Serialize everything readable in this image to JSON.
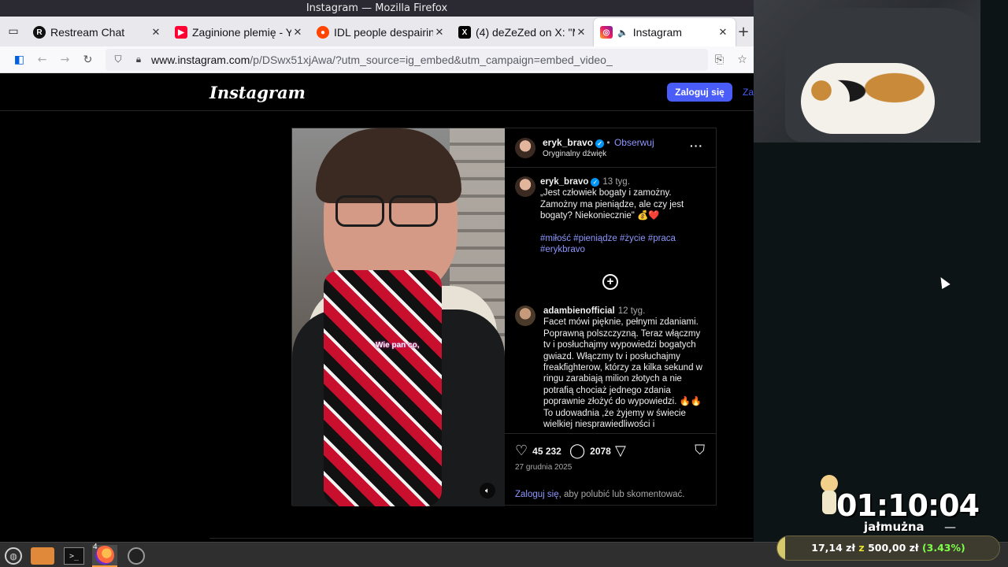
{
  "window": {
    "title": "Instagram — Mozilla Firefox"
  },
  "tabs": [
    {
      "label": "Restream Chat",
      "icon": "restream-icon",
      "active": false
    },
    {
      "label": "Zaginione plemię - Y",
      "icon": "youtube-icon",
      "active": false
    },
    {
      "label": "IDL people despairin",
      "icon": "reddit-icon",
      "active": false
    },
    {
      "label": "(4) deZeZed on X: \"M",
      "icon": "x-icon",
      "active": false
    },
    {
      "label": "Instagram",
      "icon": "instagram-icon",
      "active": true,
      "audio": true
    }
  ],
  "urlbar": {
    "host": "www.instagram.com",
    "path": "/p/DSwx51xjAwa/?utm_source=ig_embed&utm_campaign=embed_video_"
  },
  "instagram": {
    "logo": "Instagram",
    "login_label": "Zaloguj się",
    "signup_label": "Za"
  },
  "post": {
    "video_caption": "Wie pan co,",
    "author": "eryk_bravo",
    "follow_label": "Obserwuj",
    "audio_label": "Oryginalny dźwięk",
    "caption": {
      "user": "eryk_bravo",
      "time": "13 tyg.",
      "text": "„Jest człowiek bogaty i zamożny. Zamożny ma pieniądze, ale czy jest bogaty? Niekoniecznie\" 💰❤️",
      "hashtags": "#miłość #pieniądze #życie #praca #erykbravo"
    },
    "comment": {
      "user": "adambienofficial",
      "time": "12 tyg.",
      "text": "Facet mówi pięknie, pełnymi zdaniami. Poprawną polszczyzną. Teraz włączmy tv i posłuchajmy wypowiedzi bogatych gwiazd. Włączmy tv i posłuchajmy freakfighterow, którzy za kilka sekund w ringu zarabiają milion złotych a nie potrafią chociaż jednego zdania poprawnie złożyć do wypowiedzi. 🔥🔥 To udowadnia ,że żyjemy w świecie wielkiej niesprawiedliwości i"
    },
    "likes": "45 232",
    "comments_count": "2078",
    "date": "27 grudnia 2025",
    "login_prompt_link": "Zaloguj się",
    "login_prompt_rest": ", aby polubić lub skomentować."
  },
  "overlay": {
    "timer": "01:10:04",
    "charity_label": "jałmużna",
    "charity_dash": "—",
    "progress_current": "17,14 zł",
    "progress_sep": "z",
    "progress_goal": "500,00 zł",
    "progress_pct": "(3.43%)",
    "progress_fraction": 0.0343
  },
  "taskbar": {
    "firefox_badge": "4"
  },
  "colors": {
    "accent": "#4a5df9",
    "link": "#8e97ff",
    "progress_pct": "#7dff4a"
  }
}
